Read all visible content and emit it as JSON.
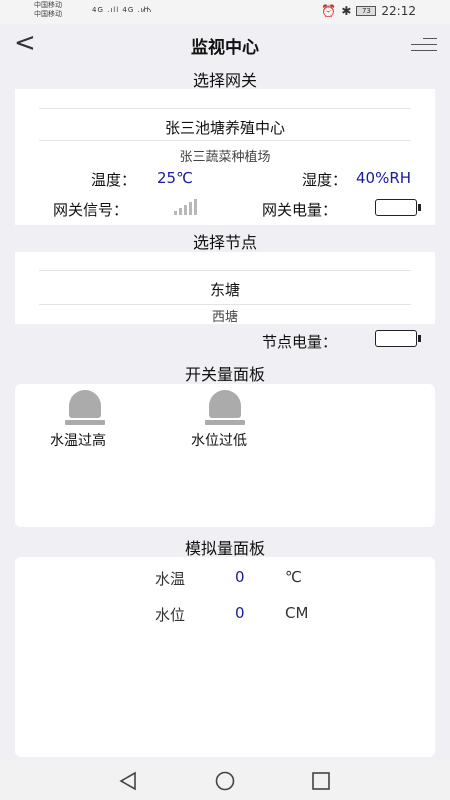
{
  "status_bar": {
    "carrier1": "中国移动",
    "carrier2": "中国移动",
    "signal": "4G .ıll  4G .ıll",
    "battery": "73",
    "time": "22:12"
  },
  "header": {
    "title": "监视中心"
  },
  "gateway": {
    "section_title": "选择网关",
    "selected": "张三池塘养殖中心",
    "next": "张三蔬菜种植场",
    "temp_label": "温度：",
    "temp_value": "25℃",
    "humidity_label": "湿度：",
    "humidity_value": "40%RH",
    "signal_label": "网关信号：",
    "power_label": "网关电量："
  },
  "node": {
    "section_title": "选择节点",
    "selected": "东塘",
    "next": "西塘",
    "power_label": "节点电量："
  },
  "switch_panel": {
    "section_title": "开关量面板",
    "items": [
      {
        "label": "水温过高",
        "icon": "alarm-light-icon"
      },
      {
        "label": "水位过低",
        "icon": "alarm-light-icon"
      }
    ]
  },
  "analog_panel": {
    "section_title": "模拟量面板",
    "rows": [
      {
        "name": "水温",
        "value": "0",
        "unit": "℃"
      },
      {
        "name": "水位",
        "value": "0",
        "unit": "CM"
      }
    ]
  },
  "colors": {
    "value_blue": "#1a1aa0",
    "background": "#efeff4",
    "icon_gray": "#ababab"
  }
}
